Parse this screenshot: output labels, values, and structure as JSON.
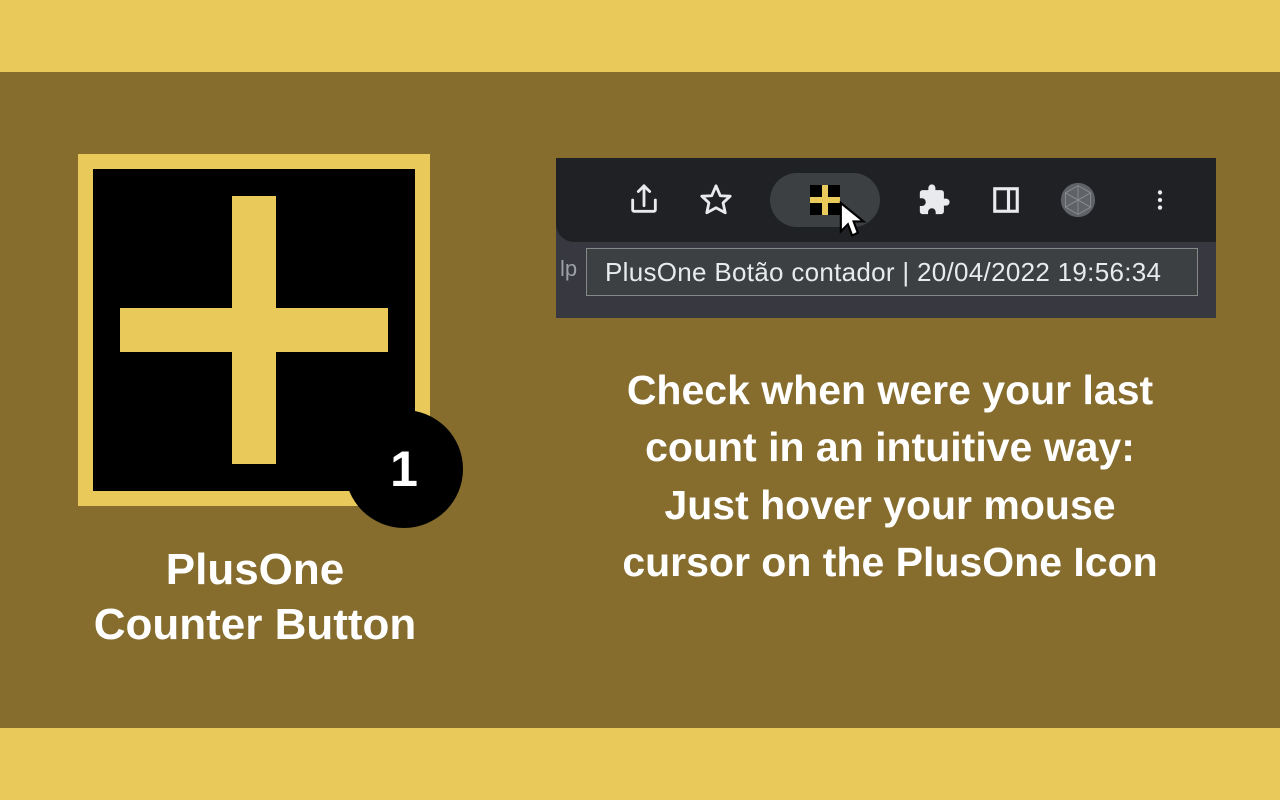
{
  "colors": {
    "accent": "#e9c95a",
    "band": "#866d2e",
    "badge": "#000000"
  },
  "icon": {
    "badge_count": "1"
  },
  "left_label": {
    "line1": "PlusOne",
    "line2": "Counter Button"
  },
  "toolbar": {
    "tooltip": "PlusOne Botão contador | 20/04/2022 19:56:34",
    "truncated_hint": "lp"
  },
  "blurb": {
    "line1": "Check when were your last",
    "line2": "count in an intuitive way:",
    "line3": "Just hover your mouse",
    "line4": "cursor on the PlusOne Icon"
  }
}
